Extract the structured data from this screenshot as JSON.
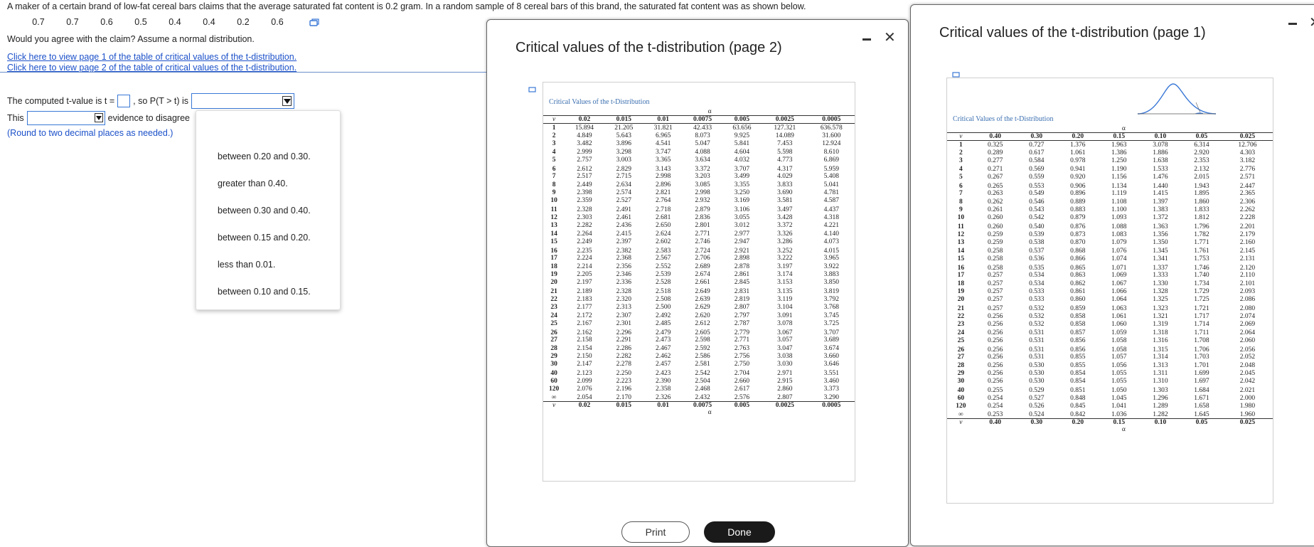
{
  "question": {
    "text": "A maker of a certain brand of low-fat cereal bars claims that the average saturated fat content is 0.2 gram. In a random sample of 8 cereal bars of this brand, the saturated fat content was as shown below.",
    "sample": [
      "0.7",
      "0.7",
      "0.6",
      "0.5",
      "0.4",
      "0.4",
      "0.2",
      "0.6"
    ],
    "prompt": "Would you agree with the claim? Assume a normal distribution.",
    "link1": "Click here to view page 1 of the table of critical values of the t-distribution.",
    "link2": "Click here to view page 2 of the table of critical values of the t-distribution."
  },
  "answer": {
    "t_label": "The computed t-value is t =",
    "p_label": ", so P(T > t) is",
    "this_label": "This",
    "evidence_label": "evidence to disagree",
    "round_note": "(Round to two decimal places as needed.)",
    "options": [
      "between 0.20 and 0.30.",
      "greater than 0.40.",
      "between 0.30 and 0.40.",
      "between 0.15 and 0.20.",
      "less than 0.01.",
      "between 0.10 and 0.15."
    ]
  },
  "win2": {
    "title": "Critical values of the t-distribution (page 2)",
    "caption": "Critical Values of the t-Distribution",
    "alpha": "α",
    "v": "v",
    "cols": [
      "0.02",
      "0.015",
      "0.01",
      "0.0075",
      "0.005",
      "0.0025",
      "0.0005"
    ],
    "rows": [
      [
        "1",
        "15.894",
        "21.205",
        "31.821",
        "42.433",
        "63.656",
        "127.321",
        "636.578"
      ],
      [
        "2",
        "4.849",
        "5.643",
        "6.965",
        "8.073",
        "9.925",
        "14.089",
        "31.600"
      ],
      [
        "3",
        "3.482",
        "3.896",
        "4.541",
        "5.047",
        "5.841",
        "7.453",
        "12.924"
      ],
      [
        "4",
        "2.999",
        "3.298",
        "3.747",
        "4.088",
        "4.604",
        "5.598",
        "8.610"
      ],
      [
        "5",
        "2.757",
        "3.003",
        "3.365",
        "3.634",
        "4.032",
        "4.773",
        "6.869"
      ],
      [
        "6",
        "2.612",
        "2.829",
        "3.143",
        "3.372",
        "3.707",
        "4.317",
        "5.959"
      ],
      [
        "7",
        "2.517",
        "2.715",
        "2.998",
        "3.203",
        "3.499",
        "4.029",
        "5.408"
      ],
      [
        "8",
        "2.449",
        "2.634",
        "2.896",
        "3.085",
        "3.355",
        "3.833",
        "5.041"
      ],
      [
        "9",
        "2.398",
        "2.574",
        "2.821",
        "2.998",
        "3.250",
        "3.690",
        "4.781"
      ],
      [
        "10",
        "2.359",
        "2.527",
        "2.764",
        "2.932",
        "3.169",
        "3.581",
        "4.587"
      ],
      [
        "11",
        "2.328",
        "2.491",
        "2.718",
        "2.879",
        "3.106",
        "3.497",
        "4.437"
      ],
      [
        "12",
        "2.303",
        "2.461",
        "2.681",
        "2.836",
        "3.055",
        "3.428",
        "4.318"
      ],
      [
        "13",
        "2.282",
        "2.436",
        "2.650",
        "2.801",
        "3.012",
        "3.372",
        "4.221"
      ],
      [
        "14",
        "2.264",
        "2.415",
        "2.624",
        "2.771",
        "2.977",
        "3.326",
        "4.140"
      ],
      [
        "15",
        "2.249",
        "2.397",
        "2.602",
        "2.746",
        "2.947",
        "3.286",
        "4.073"
      ],
      [
        "16",
        "2.235",
        "2.382",
        "2.583",
        "2.724",
        "2.921",
        "3.252",
        "4.015"
      ],
      [
        "17",
        "2.224",
        "2.368",
        "2.567",
        "2.706",
        "2.898",
        "3.222",
        "3.965"
      ],
      [
        "18",
        "2.214",
        "2.356",
        "2.552",
        "2.689",
        "2.878",
        "3.197",
        "3.922"
      ],
      [
        "19",
        "2.205",
        "2.346",
        "2.539",
        "2.674",
        "2.861",
        "3.174",
        "3.883"
      ],
      [
        "20",
        "2.197",
        "2.336",
        "2.528",
        "2.661",
        "2.845",
        "3.153",
        "3.850"
      ],
      [
        "21",
        "2.189",
        "2.328",
        "2.518",
        "2.649",
        "2.831",
        "3.135",
        "3.819"
      ],
      [
        "22",
        "2.183",
        "2.320",
        "2.508",
        "2.639",
        "2.819",
        "3.119",
        "3.792"
      ],
      [
        "23",
        "2.177",
        "2.313",
        "2.500",
        "2.629",
        "2.807",
        "3.104",
        "3.768"
      ],
      [
        "24",
        "2.172",
        "2.307",
        "2.492",
        "2.620",
        "2.797",
        "3.091",
        "3.745"
      ],
      [
        "25",
        "2.167",
        "2.301",
        "2.485",
        "2.612",
        "2.787",
        "3.078",
        "3.725"
      ],
      [
        "26",
        "2.162",
        "2.296",
        "2.479",
        "2.605",
        "2.779",
        "3.067",
        "3.707"
      ],
      [
        "27",
        "2.158",
        "2.291",
        "2.473",
        "2.598",
        "2.771",
        "3.057",
        "3.689"
      ],
      [
        "28",
        "2.154",
        "2.286",
        "2.467",
        "2.592",
        "2.763",
        "3.047",
        "3.674"
      ],
      [
        "29",
        "2.150",
        "2.282",
        "2.462",
        "2.586",
        "2.756",
        "3.038",
        "3.660"
      ],
      [
        "30",
        "2.147",
        "2.278",
        "2.457",
        "2.581",
        "2.750",
        "3.030",
        "3.646"
      ],
      [
        "40",
        "2.123",
        "2.250",
        "2.423",
        "2.542",
        "2.704",
        "2.971",
        "3.551"
      ],
      [
        "60",
        "2.099",
        "2.223",
        "2.390",
        "2.504",
        "2.660",
        "2.915",
        "3.460"
      ],
      [
        "120",
        "2.076",
        "2.196",
        "2.358",
        "2.468",
        "2.617",
        "2.860",
        "3.373"
      ],
      [
        "∞",
        "2.054",
        "2.170",
        "2.326",
        "2.432",
        "2.576",
        "2.807",
        "3.290"
      ]
    ],
    "print_label": "Print",
    "done_label": "Done"
  },
  "win1": {
    "title": "Critical values of the t-distribution (page 1)",
    "caption": "Critical Values of the t-Distribution",
    "alpha": "α",
    "v": "v",
    "cols": [
      "0.40",
      "0.30",
      "0.20",
      "0.15",
      "0.10",
      "0.05",
      "0.025"
    ],
    "rows": [
      [
        "1",
        "0.325",
        "0.727",
        "1.376",
        "1.963",
        "3.078",
        "6.314",
        "12.706"
      ],
      [
        "2",
        "0.289",
        "0.617",
        "1.061",
        "1.386",
        "1.886",
        "2.920",
        "4.303"
      ],
      [
        "3",
        "0.277",
        "0.584",
        "0.978",
        "1.250",
        "1.638",
        "2.353",
        "3.182"
      ],
      [
        "4",
        "0.271",
        "0.569",
        "0.941",
        "1.190",
        "1.533",
        "2.132",
        "2.776"
      ],
      [
        "5",
        "0.267",
        "0.559",
        "0.920",
        "1.156",
        "1.476",
        "2.015",
        "2.571"
      ],
      [
        "6",
        "0.265",
        "0.553",
        "0.906",
        "1.134",
        "1.440",
        "1.943",
        "2.447"
      ],
      [
        "7",
        "0.263",
        "0.549",
        "0.896",
        "1.119",
        "1.415",
        "1.895",
        "2.365"
      ],
      [
        "8",
        "0.262",
        "0.546",
        "0.889",
        "1.108",
        "1.397",
        "1.860",
        "2.306"
      ],
      [
        "9",
        "0.261",
        "0.543",
        "0.883",
        "1.100",
        "1.383",
        "1.833",
        "2.262"
      ],
      [
        "10",
        "0.260",
        "0.542",
        "0.879",
        "1.093",
        "1.372",
        "1.812",
        "2.228"
      ],
      [
        "11",
        "0.260",
        "0.540",
        "0.876",
        "1.088",
        "1.363",
        "1.796",
        "2.201"
      ],
      [
        "12",
        "0.259",
        "0.539",
        "0.873",
        "1.083",
        "1.356",
        "1.782",
        "2.179"
      ],
      [
        "13",
        "0.259",
        "0.538",
        "0.870",
        "1.079",
        "1.350",
        "1.771",
        "2.160"
      ],
      [
        "14",
        "0.258",
        "0.537",
        "0.868",
        "1.076",
        "1.345",
        "1.761",
        "2.145"
      ],
      [
        "15",
        "0.258",
        "0.536",
        "0.866",
        "1.074",
        "1.341",
        "1.753",
        "2.131"
      ],
      [
        "16",
        "0.258",
        "0.535",
        "0.865",
        "1.071",
        "1.337",
        "1.746",
        "2.120"
      ],
      [
        "17",
        "0.257",
        "0.534",
        "0.863",
        "1.069",
        "1.333",
        "1.740",
        "2.110"
      ],
      [
        "18",
        "0.257",
        "0.534",
        "0.862",
        "1.067",
        "1.330",
        "1.734",
        "2.101"
      ],
      [
        "19",
        "0.257",
        "0.533",
        "0.861",
        "1.066",
        "1.328",
        "1.729",
        "2.093"
      ],
      [
        "20",
        "0.257",
        "0.533",
        "0.860",
        "1.064",
        "1.325",
        "1.725",
        "2.086"
      ],
      [
        "21",
        "0.257",
        "0.532",
        "0.859",
        "1.063",
        "1.323",
        "1.721",
        "2.080"
      ],
      [
        "22",
        "0.256",
        "0.532",
        "0.858",
        "1.061",
        "1.321",
        "1.717",
        "2.074"
      ],
      [
        "23",
        "0.256",
        "0.532",
        "0.858",
        "1.060",
        "1.319",
        "1.714",
        "2.069"
      ],
      [
        "24",
        "0.256",
        "0.531",
        "0.857",
        "1.059",
        "1.318",
        "1.711",
        "2.064"
      ],
      [
        "25",
        "0.256",
        "0.531",
        "0.856",
        "1.058",
        "1.316",
        "1.708",
        "2.060"
      ],
      [
        "26",
        "0.256",
        "0.531",
        "0.856",
        "1.058",
        "1.315",
        "1.706",
        "2.056"
      ],
      [
        "27",
        "0.256",
        "0.531",
        "0.855",
        "1.057",
        "1.314",
        "1.703",
        "2.052"
      ],
      [
        "28",
        "0.256",
        "0.530",
        "0.855",
        "1.056",
        "1.313",
        "1.701",
        "2.048"
      ],
      [
        "29",
        "0.256",
        "0.530",
        "0.854",
        "1.055",
        "1.311",
        "1.699",
        "2.045"
      ],
      [
        "30",
        "0.256",
        "0.530",
        "0.854",
        "1.055",
        "1.310",
        "1.697",
        "2.042"
      ],
      [
        "40",
        "0.255",
        "0.529",
        "0.851",
        "1.050",
        "1.303",
        "1.684",
        "2.021"
      ],
      [
        "60",
        "0.254",
        "0.527",
        "0.848",
        "1.045",
        "1.296",
        "1.671",
        "2.000"
      ],
      [
        "120",
        "0.254",
        "0.526",
        "0.845",
        "1.041",
        "1.289",
        "1.658",
        "1.980"
      ],
      [
        "∞",
        "0.253",
        "0.524",
        "0.842",
        "1.036",
        "1.282",
        "1.645",
        "1.960"
      ]
    ]
  }
}
